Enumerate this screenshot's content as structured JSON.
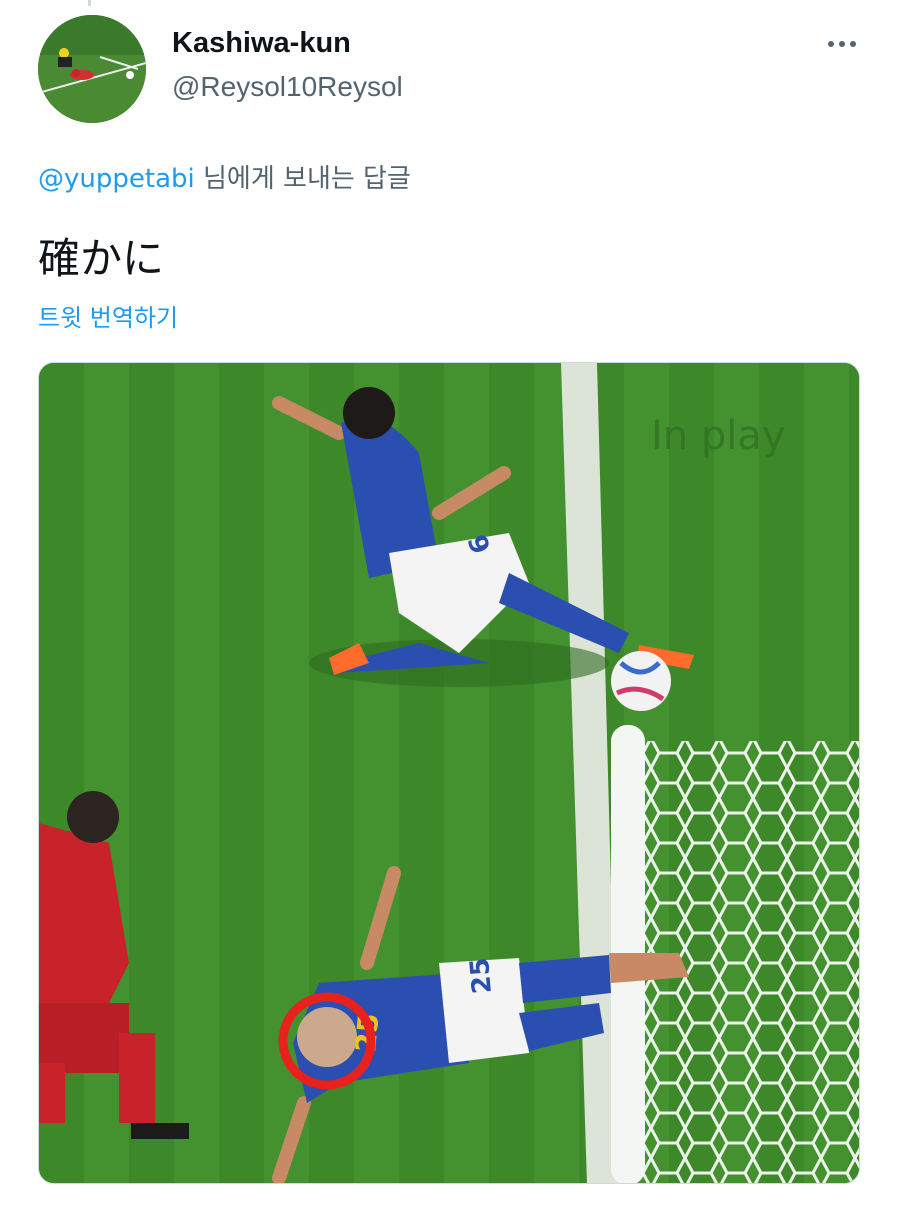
{
  "tweet": {
    "author": {
      "display_name": "Kashiwa-kun",
      "handle": "@Reysol10Reysol",
      "avatar_icon": "avatar-soccer-photo"
    },
    "more_icon": "more-dots-icon",
    "reply_context": {
      "mention": "@yuppetabi",
      "suffix": " 님에게 보내는 답글"
    },
    "text": "確かに",
    "translate_label": "트윗 번역하기",
    "media": {
      "watermark": "In play",
      "player_numbers": [
        "9",
        "25",
        "25"
      ],
      "colors": {
        "pitch": "#3f8a2a",
        "japan_kit": "#2a4fb0",
        "spain_kit": "#c8222b",
        "highlight_circle": "#e8201e",
        "link": "#1d9bf0"
      }
    }
  }
}
